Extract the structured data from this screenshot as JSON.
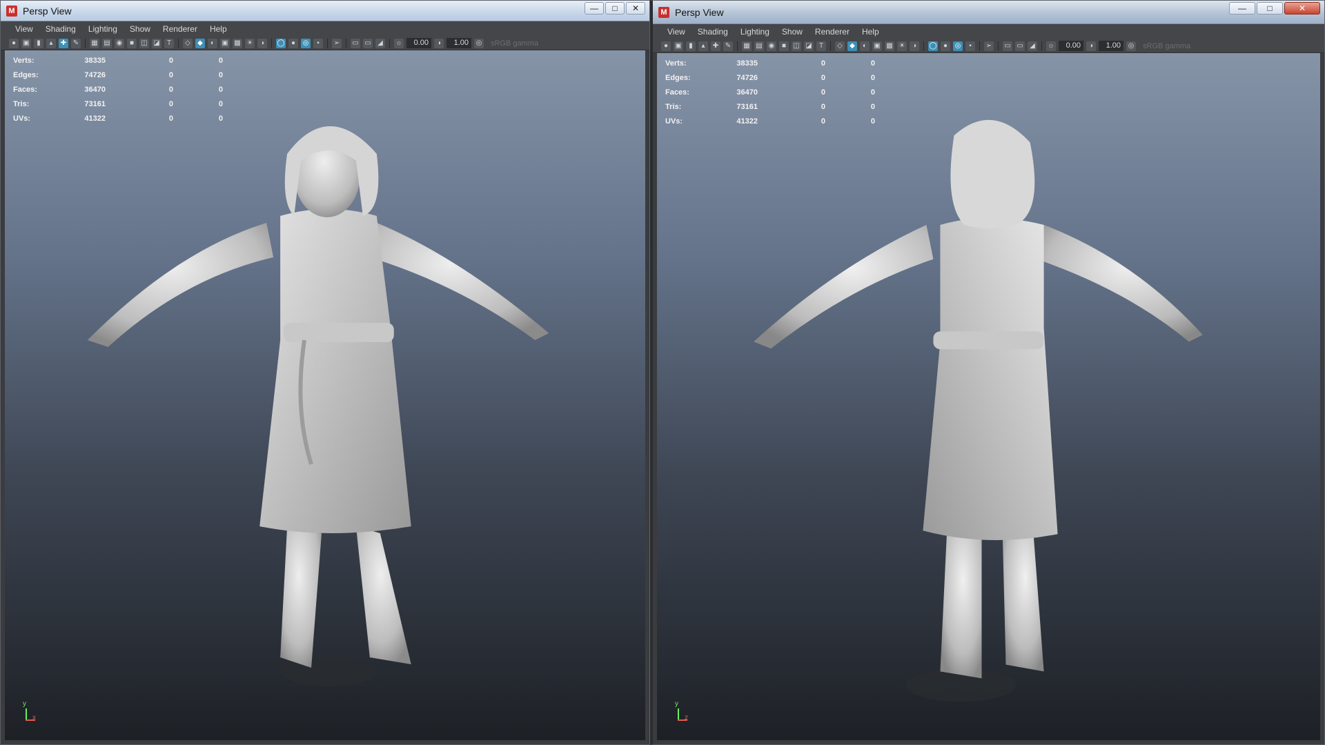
{
  "windows": [
    {
      "title": "Persp View",
      "app_icon": "M",
      "menu": [
        "View",
        "Shading",
        "Lighting",
        "Show",
        "Renderer",
        "Help"
      ],
      "toolbar": {
        "exposure": "0.00",
        "gamma": "1.00",
        "color_space": "sRGB gamma"
      },
      "stats": [
        {
          "label": "Verts:",
          "value": "38335",
          "sel": "0",
          "tri": "0"
        },
        {
          "label": "Edges:",
          "value": "74726",
          "sel": "0",
          "tri": "0"
        },
        {
          "label": "Faces:",
          "value": "36470",
          "sel": "0",
          "tri": "0"
        },
        {
          "label": "Tris:",
          "value": "73161",
          "sel": "0",
          "tri": "0"
        },
        {
          "label": "UVs:",
          "value": "41322",
          "sel": "0",
          "tri": "0"
        }
      ],
      "axis": {
        "y": "y",
        "x": "x"
      }
    },
    {
      "title": "Persp View",
      "app_icon": "M",
      "menu": [
        "View",
        "Shading",
        "Lighting",
        "Show",
        "Renderer",
        "Help"
      ],
      "toolbar": {
        "exposure": "0.00",
        "gamma": "1.00",
        "color_space": "sRGB gamma"
      },
      "stats": [
        {
          "label": "Verts:",
          "value": "38335",
          "sel": "0",
          "tri": "0"
        },
        {
          "label": "Edges:",
          "value": "74726",
          "sel": "0",
          "tri": "0"
        },
        {
          "label": "Faces:",
          "value": "36470",
          "sel": "0",
          "tri": "0"
        },
        {
          "label": "Tris:",
          "value": "73161",
          "sel": "0",
          "tri": "0"
        },
        {
          "label": "UVs:",
          "value": "41322",
          "sel": "0",
          "tri": "0"
        }
      ],
      "axis": {
        "y": "y",
        "x": "z"
      }
    }
  ],
  "colors": {
    "viewport_top": "#8694a8",
    "viewport_bottom": "#1d2025",
    "active_icon": "#3e8fb6",
    "axis_y": "#6cf05e",
    "axis_x": "#e15a4f"
  },
  "icons": [
    "camera-icon",
    "grid-icon",
    "wireframe-icon",
    "smooth-shade-icon",
    "light-icon",
    "isolate-icon",
    "exposure-icon",
    "gamma-icon"
  ]
}
